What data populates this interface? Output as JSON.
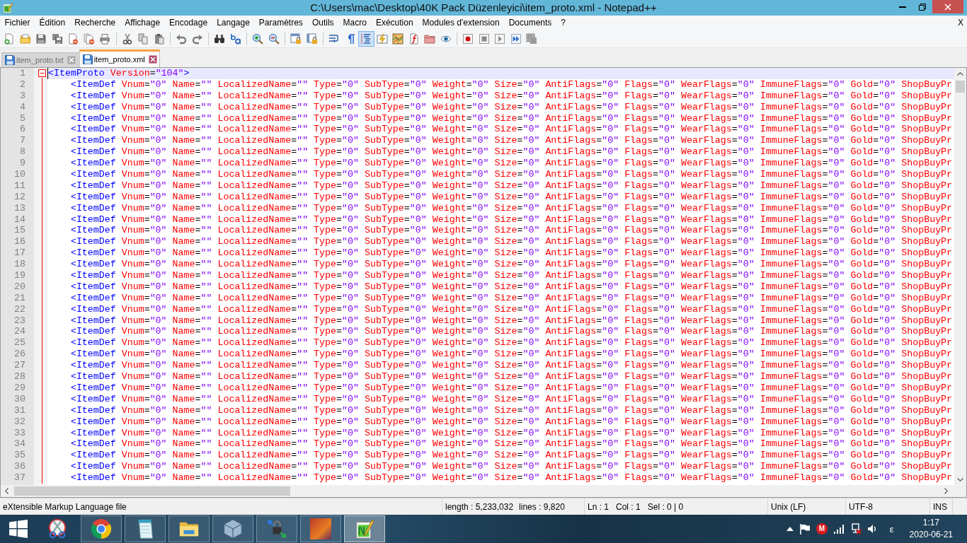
{
  "window": {
    "title": "C:\\Users\\mac\\Desktop\\40K Pack Düzenleyici\\item_proto.xml - Notepad++"
  },
  "menu": {
    "items": [
      "Fichier",
      "Édition",
      "Recherche",
      "Affichage",
      "Encodage",
      "Langage",
      "Paramètres",
      "Outils",
      "Macro",
      "Exécution",
      "Modules d'extension",
      "Documents",
      "?"
    ],
    "close_label": "X"
  },
  "toolbar": {
    "groups": [
      {
        "buttons": [
          {
            "kind": "new",
            "pressed": false
          },
          {
            "kind": "open",
            "pressed": false
          },
          {
            "kind": "save",
            "pressed": false
          },
          {
            "kind": "save-all",
            "pressed": false
          },
          {
            "kind": "close",
            "pressed": false
          },
          {
            "kind": "close-all",
            "pressed": false
          },
          {
            "kind": "print",
            "pressed": false
          }
        ]
      },
      {
        "buttons": [
          {
            "kind": "cut",
            "pressed": false
          },
          {
            "kind": "copy",
            "pressed": false
          },
          {
            "kind": "paste",
            "pressed": false
          }
        ]
      },
      {
        "buttons": [
          {
            "kind": "undo",
            "pressed": false
          },
          {
            "kind": "redo",
            "pressed": false
          }
        ]
      },
      {
        "buttons": [
          {
            "kind": "find",
            "pressed": false
          },
          {
            "kind": "replace",
            "pressed": false
          }
        ]
      },
      {
        "buttons": [
          {
            "kind": "zoom-in",
            "pressed": false
          },
          {
            "kind": "zoom-out",
            "pressed": false
          }
        ]
      },
      {
        "buttons": [
          {
            "kind": "sync-vertical",
            "pressed": false
          },
          {
            "kind": "sync-horizontal",
            "pressed": false
          }
        ]
      },
      {
        "buttons": [
          {
            "kind": "word-wrap",
            "pressed": false
          },
          {
            "kind": "all-characters",
            "pressed": false
          },
          {
            "kind": "indent-guide",
            "pressed": true
          },
          {
            "kind": "user-language",
            "pressed": false
          },
          {
            "kind": "document-map",
            "pressed": false
          },
          {
            "kind": "function-list",
            "pressed": false
          },
          {
            "kind": "folder-workspace",
            "pressed": false
          },
          {
            "kind": "monitoring",
            "pressed": false
          }
        ]
      },
      {
        "buttons": [
          {
            "kind": "record",
            "pressed": false
          },
          {
            "kind": "stop",
            "pressed": false
          },
          {
            "kind": "play",
            "pressed": false
          },
          {
            "kind": "play-repeat",
            "pressed": false
          },
          {
            "kind": "save-macro",
            "pressed": false
          }
        ]
      }
    ]
  },
  "tabs": [
    {
      "label": "item_proto.txt",
      "selected": false
    },
    {
      "label": "item_proto.xml",
      "selected": true
    }
  ],
  "editor": {
    "lines": [
      {
        "number": "1",
        "text": "<ItemProto Version=\"104\">",
        "current": true,
        "expanded": true,
        "children": [
          {
            "number": "2",
            "text": "<ItemDef Vnum=\"0\" Name=\"\" LocalizedName=\"\" Type=\"0\" SubType=\"0\" Weight=\"0\" Size=\"0\" AntiFlags=\"0\" Flags=\"0\" WearFlags=\"0\" ImmuneFlags=\"0\" Gold=\"0\" ShopBuyPr",
            "current": false
          },
          {
            "number": "3",
            "text": "<ItemDef Vnum=\"0\" Name=\"\" LocalizedName=\"\" Type=\"0\" SubType=\"0\" Weight=\"0\" Size=\"0\" AntiFlags=\"0\" Flags=\"0\" WearFlags=\"0\" ImmuneFlags=\"0\" Gold=\"0\" ShopBuyPr",
            "current": false
          },
          {
            "number": "4",
            "text": "<ItemDef Vnum=\"0\" Name=\"\" LocalizedName=\"\" Type=\"0\" SubType=\"0\" Weight=\"0\" Size=\"0\" AntiFlags=\"0\" Flags=\"0\" WearFlags=\"0\" ImmuneFlags=\"0\" Gold=\"0\" ShopBuyPr",
            "current": false
          },
          {
            "number": "5",
            "text": "<ItemDef Vnum=\"0\" Name=\"\" LocalizedName=\"\" Type=\"0\" SubType=\"0\" Weight=\"0\" Size=\"0\" AntiFlags=\"0\" Flags=\"0\" WearFlags=\"0\" ImmuneFlags=\"0\" Gold=\"0\" ShopBuyPr",
            "current": false
          },
          {
            "number": "6",
            "text": "<ItemDef Vnum=\"0\" Name=\"\" LocalizedName=\"\" Type=\"0\" SubType=\"0\" Weight=\"0\" Size=\"0\" AntiFlags=\"0\" Flags=\"0\" WearFlags=\"0\" ImmuneFlags=\"0\" Gold=\"0\" ShopBuyPr",
            "current": false
          },
          {
            "number": "7",
            "text": "<ItemDef Vnum=\"0\" Name=\"\" LocalizedName=\"\" Type=\"0\" SubType=\"0\" Weight=\"0\" Size=\"0\" AntiFlags=\"0\" Flags=\"0\" WearFlags=\"0\" ImmuneFlags=\"0\" Gold=\"0\" ShopBuyPr",
            "current": false
          },
          {
            "number": "8",
            "text": "<ItemDef Vnum=\"0\" Name=\"\" LocalizedName=\"\" Type=\"0\" SubType=\"0\" Weight=\"0\" Size=\"0\" AntiFlags=\"0\" Flags=\"0\" WearFlags=\"0\" ImmuneFlags=\"0\" Gold=\"0\" ShopBuyPr",
            "current": false
          },
          {
            "number": "9",
            "text": "<ItemDef Vnum=\"0\" Name=\"\" LocalizedName=\"\" Type=\"0\" SubType=\"0\" Weight=\"0\" Size=\"0\" AntiFlags=\"0\" Flags=\"0\" WearFlags=\"0\" ImmuneFlags=\"0\" Gold=\"0\" ShopBuyPr",
            "current": false
          },
          {
            "number": "10",
            "text": "<ItemDef Vnum=\"0\" Name=\"\" LocalizedName=\"\" Type=\"0\" SubType=\"0\" Weight=\"0\" Size=\"0\" AntiFlags=\"0\" Flags=\"0\" WearFlags=\"0\" ImmuneFlags=\"0\" Gold=\"0\" ShopBuyPr",
            "current": false
          },
          {
            "number": "11",
            "text": "<ItemDef Vnum=\"0\" Name=\"\" LocalizedName=\"\" Type=\"0\" SubType=\"0\" Weight=\"0\" Size=\"0\" AntiFlags=\"0\" Flags=\"0\" WearFlags=\"0\" ImmuneFlags=\"0\" Gold=\"0\" ShopBuyPr",
            "current": false
          },
          {
            "number": "12",
            "text": "<ItemDef Vnum=\"0\" Name=\"\" LocalizedName=\"\" Type=\"0\" SubType=\"0\" Weight=\"0\" Size=\"0\" AntiFlags=\"0\" Flags=\"0\" WearFlags=\"0\" ImmuneFlags=\"0\" Gold=\"0\" ShopBuyPr",
            "current": false
          },
          {
            "number": "13",
            "text": "<ItemDef Vnum=\"0\" Name=\"\" LocalizedName=\"\" Type=\"0\" SubType=\"0\" Weight=\"0\" Size=\"0\" AntiFlags=\"0\" Flags=\"0\" WearFlags=\"0\" ImmuneFlags=\"0\" Gold=\"0\" ShopBuyPr",
            "current": false
          },
          {
            "number": "14",
            "text": "<ItemDef Vnum=\"0\" Name=\"\" LocalizedName=\"\" Type=\"0\" SubType=\"0\" Weight=\"0\" Size=\"0\" AntiFlags=\"0\" Flags=\"0\" WearFlags=\"0\" ImmuneFlags=\"0\" Gold=\"0\" ShopBuyPr",
            "current": false
          },
          {
            "number": "15",
            "text": "<ItemDef Vnum=\"0\" Name=\"\" LocalizedName=\"\" Type=\"0\" SubType=\"0\" Weight=\"0\" Size=\"0\" AntiFlags=\"0\" Flags=\"0\" WearFlags=\"0\" ImmuneFlags=\"0\" Gold=\"0\" ShopBuyPr",
            "current": false
          },
          {
            "number": "16",
            "text": "<ItemDef Vnum=\"0\" Name=\"\" LocalizedName=\"\" Type=\"0\" SubType=\"0\" Weight=\"0\" Size=\"0\" AntiFlags=\"0\" Flags=\"0\" WearFlags=\"0\" ImmuneFlags=\"0\" Gold=\"0\" ShopBuyPr",
            "current": false
          },
          {
            "number": "17",
            "text": "<ItemDef Vnum=\"0\" Name=\"\" LocalizedName=\"\" Type=\"0\" SubType=\"0\" Weight=\"0\" Size=\"0\" AntiFlags=\"0\" Flags=\"0\" WearFlags=\"0\" ImmuneFlags=\"0\" Gold=\"0\" ShopBuyPr",
            "current": false
          },
          {
            "number": "18",
            "text": "<ItemDef Vnum=\"0\" Name=\"\" LocalizedName=\"\" Type=\"0\" SubType=\"0\" Weight=\"0\" Size=\"0\" AntiFlags=\"0\" Flags=\"0\" WearFlags=\"0\" ImmuneFlags=\"0\" Gold=\"0\" ShopBuyPr",
            "current": false
          },
          {
            "number": "19",
            "text": "<ItemDef Vnum=\"0\" Name=\"\" LocalizedName=\"\" Type=\"0\" SubType=\"0\" Weight=\"0\" Size=\"0\" AntiFlags=\"0\" Flags=\"0\" WearFlags=\"0\" ImmuneFlags=\"0\" Gold=\"0\" ShopBuyPr",
            "current": false
          },
          {
            "number": "20",
            "text": "<ItemDef Vnum=\"0\" Name=\"\" LocalizedName=\"\" Type=\"0\" SubType=\"0\" Weight=\"0\" Size=\"0\" AntiFlags=\"0\" Flags=\"0\" WearFlags=\"0\" ImmuneFlags=\"0\" Gold=\"0\" ShopBuyPr",
            "current": false
          },
          {
            "number": "21",
            "text": "<ItemDef Vnum=\"0\" Name=\"\" LocalizedName=\"\" Type=\"0\" SubType=\"0\" Weight=\"0\" Size=\"0\" AntiFlags=\"0\" Flags=\"0\" WearFlags=\"0\" ImmuneFlags=\"0\" Gold=\"0\" ShopBuyPr",
            "current": false
          },
          {
            "number": "22",
            "text": "<ItemDef Vnum=\"0\" Name=\"\" LocalizedName=\"\" Type=\"0\" SubType=\"0\" Weight=\"0\" Size=\"0\" AntiFlags=\"0\" Flags=\"0\" WearFlags=\"0\" ImmuneFlags=\"0\" Gold=\"0\" ShopBuyPr",
            "current": false
          },
          {
            "number": "23",
            "text": "<ItemDef Vnum=\"0\" Name=\"\" LocalizedName=\"\" Type=\"0\" SubType=\"0\" Weight=\"0\" Size=\"0\" AntiFlags=\"0\" Flags=\"0\" WearFlags=\"0\" ImmuneFlags=\"0\" Gold=\"0\" ShopBuyPr",
            "current": false
          },
          {
            "number": "24",
            "text": "<ItemDef Vnum=\"0\" Name=\"\" LocalizedName=\"\" Type=\"0\" SubType=\"0\" Weight=\"0\" Size=\"0\" AntiFlags=\"0\" Flags=\"0\" WearFlags=\"0\" ImmuneFlags=\"0\" Gold=\"0\" ShopBuyPr",
            "current": false
          },
          {
            "number": "25",
            "text": "<ItemDef Vnum=\"0\" Name=\"\" LocalizedName=\"\" Type=\"0\" SubType=\"0\" Weight=\"0\" Size=\"0\" AntiFlags=\"0\" Flags=\"0\" WearFlags=\"0\" ImmuneFlags=\"0\" Gold=\"0\" ShopBuyPr",
            "current": false
          },
          {
            "number": "26",
            "text": "<ItemDef Vnum=\"0\" Name=\"\" LocalizedName=\"\" Type=\"0\" SubType=\"0\" Weight=\"0\" Size=\"0\" AntiFlags=\"0\" Flags=\"0\" WearFlags=\"0\" ImmuneFlags=\"0\" Gold=\"0\" ShopBuyPr",
            "current": false
          },
          {
            "number": "27",
            "text": "<ItemDef Vnum=\"0\" Name=\"\" LocalizedName=\"\" Type=\"0\" SubType=\"0\" Weight=\"0\" Size=\"0\" AntiFlags=\"0\" Flags=\"0\" WearFlags=\"0\" ImmuneFlags=\"0\" Gold=\"0\" ShopBuyPr",
            "current": false
          },
          {
            "number": "28",
            "text": "<ItemDef Vnum=\"0\" Name=\"\" LocalizedName=\"\" Type=\"0\" SubType=\"0\" Weight=\"0\" Size=\"0\" AntiFlags=\"0\" Flags=\"0\" WearFlags=\"0\" ImmuneFlags=\"0\" Gold=\"0\" ShopBuyPr",
            "current": false
          },
          {
            "number": "29",
            "text": "<ItemDef Vnum=\"0\" Name=\"\" LocalizedName=\"\" Type=\"0\" SubType=\"0\" Weight=\"0\" Size=\"0\" AntiFlags=\"0\" Flags=\"0\" WearFlags=\"0\" ImmuneFlags=\"0\" Gold=\"0\" ShopBuyPr",
            "current": false
          },
          {
            "number": "30",
            "text": "<ItemDef Vnum=\"0\" Name=\"\" LocalizedName=\"\" Type=\"0\" SubType=\"0\" Weight=\"0\" Size=\"0\" AntiFlags=\"0\" Flags=\"0\" WearFlags=\"0\" ImmuneFlags=\"0\" Gold=\"0\" ShopBuyPr",
            "current": false
          },
          {
            "number": "31",
            "text": "<ItemDef Vnum=\"0\" Name=\"\" LocalizedName=\"\" Type=\"0\" SubType=\"0\" Weight=\"0\" Size=\"0\" AntiFlags=\"0\" Flags=\"0\" WearFlags=\"0\" ImmuneFlags=\"0\" Gold=\"0\" ShopBuyPr",
            "current": false
          },
          {
            "number": "32",
            "text": "<ItemDef Vnum=\"0\" Name=\"\" LocalizedName=\"\" Type=\"0\" SubType=\"0\" Weight=\"0\" Size=\"0\" AntiFlags=\"0\" Flags=\"0\" WearFlags=\"0\" ImmuneFlags=\"0\" Gold=\"0\" ShopBuyPr",
            "current": false
          },
          {
            "number": "33",
            "text": "<ItemDef Vnum=\"0\" Name=\"\" LocalizedName=\"\" Type=\"0\" SubType=\"0\" Weight=\"0\" Size=\"0\" AntiFlags=\"0\" Flags=\"0\" WearFlags=\"0\" ImmuneFlags=\"0\" Gold=\"0\" ShopBuyPr",
            "current": false
          },
          {
            "number": "34",
            "text": "<ItemDef Vnum=\"0\" Name=\"\" LocalizedName=\"\" Type=\"0\" SubType=\"0\" Weight=\"0\" Size=\"0\" AntiFlags=\"0\" Flags=\"0\" WearFlags=\"0\" ImmuneFlags=\"0\" Gold=\"0\" ShopBuyPr",
            "current": false
          },
          {
            "number": "35",
            "text": "<ItemDef Vnum=\"0\" Name=\"\" LocalizedName=\"\" Type=\"0\" SubType=\"0\" Weight=\"0\" Size=\"0\" AntiFlags=\"0\" Flags=\"0\" WearFlags=\"0\" ImmuneFlags=\"0\" Gold=\"0\" ShopBuyPr",
            "current": false
          },
          {
            "number": "36",
            "text": "<ItemDef Vnum=\"0\" Name=\"\" LocalizedName=\"\" Type=\"0\" SubType=\"0\" Weight=\"0\" Size=\"0\" AntiFlags=\"0\" Flags=\"0\" WearFlags=\"0\" ImmuneFlags=\"0\" Gold=\"0\" ShopBuyPr",
            "current": false
          },
          {
            "number": "37",
            "text": "<ItemDef Vnum=\"0\" Name=\"\" LocalizedName=\"\" Type=\"0\" SubType=\"0\" Weight=\"0\" Size=\"0\" AntiFlags=\"0\" Flags=\"0\" WearFlags=\"0\" ImmuneFlags=\"0\" Gold=\"0\" ShopBuyPr",
            "current": false
          }
        ]
      }
    ]
  },
  "status_bar": {
    "file_type": "eXtensible Markup Language file",
    "length": "length : 5,233,032",
    "lines": "lines : 9,820",
    "line": "Ln : 1",
    "column": "Col : 1",
    "selection": "Sel : 0 | 0",
    "eol": "Unix (LF)",
    "encoding": "UTF-8",
    "mode": "INS"
  },
  "taskbar": {
    "apps": [
      {
        "kind": "scissors",
        "running": false,
        "active": false
      },
      {
        "kind": "browser",
        "running": true,
        "active": false
      },
      {
        "kind": "notepad",
        "running": true,
        "active": false
      },
      {
        "kind": "folder",
        "running": true,
        "active": false
      },
      {
        "kind": "cube",
        "running": true,
        "active": false
      },
      {
        "kind": "lock",
        "running": true,
        "active": false
      },
      {
        "kind": "game",
        "running": true,
        "active": false
      },
      {
        "kind": "editor",
        "running": true,
        "active": true
      }
    ]
  },
  "tray": {
    "badge": "M",
    "language": "ε",
    "time": "1:17",
    "date": "2020-06-21"
  }
}
